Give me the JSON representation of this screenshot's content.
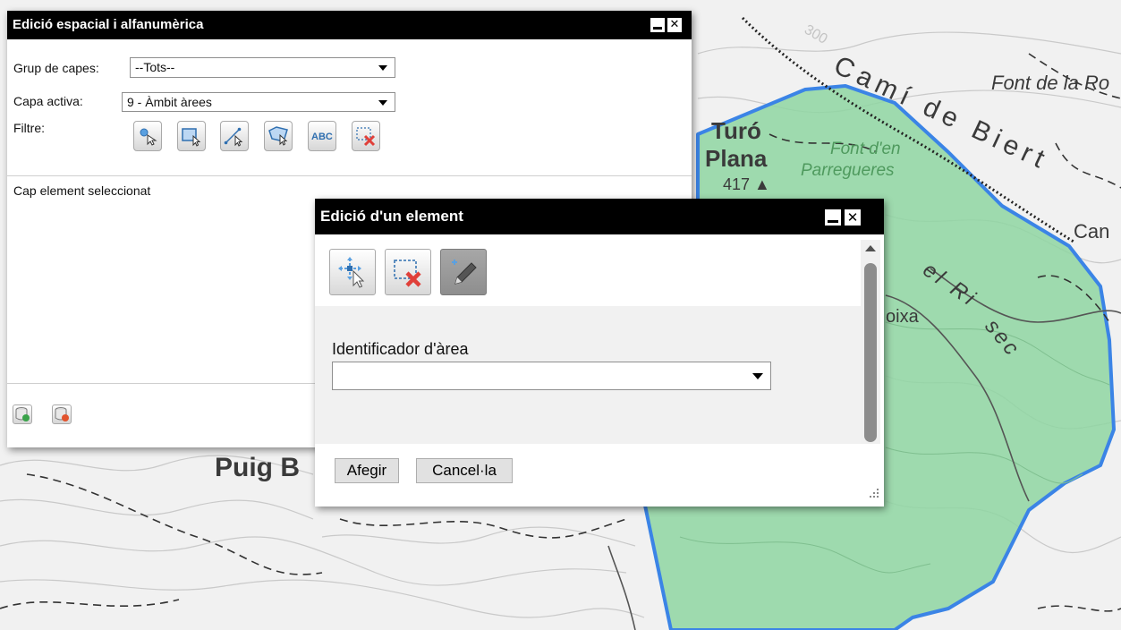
{
  "map": {
    "labels": {
      "road_name": "Camí de Biert",
      "font_de_la_ro": "Font de la Ro",
      "turo": "Turó",
      "plana": "Plana",
      "elevation": "417 ▲",
      "font_den": "Font d'en",
      "parregueres": "Parregueres",
      "can": "Can",
      "el_ri": "el Ri",
      "sec": "sec",
      "oixa": "oixa",
      "puig": "Puig B",
      "contour_num": "300"
    },
    "colors": {
      "background": "#f1f1f1",
      "area_fill": "#8fd6a2",
      "area_border": "#3b84e6",
      "contour": "#c9c9c9",
      "water": "#909090",
      "label": "#3a3a3a",
      "green_label": "#4f9a5e"
    }
  },
  "main_window": {
    "title": "Edició espacial i alfanumèrica",
    "layer_group_label": "Grup de capes:",
    "layer_group_value": "--Tots--",
    "active_layer_label": "Capa activa:",
    "active_layer_value": "9 - Àmbit àrees",
    "filter_label": "Filtre:",
    "filter_tools": [
      "point-select-icon",
      "rectangle-select-icon",
      "line-select-icon",
      "polygon-select-icon",
      "abc-text-icon",
      "clear-selection-icon"
    ],
    "filter_text_icon_label": "ABC",
    "status_text": "Cap element seleccionat",
    "bottom_buttons": [
      "add-layer-icon",
      "remove-layer-icon"
    ]
  },
  "element_dialog": {
    "title": "Edició d'un element",
    "tools": [
      "move-vertex-icon",
      "delete-element-icon",
      "edit-pencil-icon"
    ],
    "pressed_tool": "edit-pencil-icon",
    "field_label": "Identificador d'àrea",
    "field_value": "",
    "add_button": "Afegir",
    "cancel_button": "Cancel·la"
  }
}
